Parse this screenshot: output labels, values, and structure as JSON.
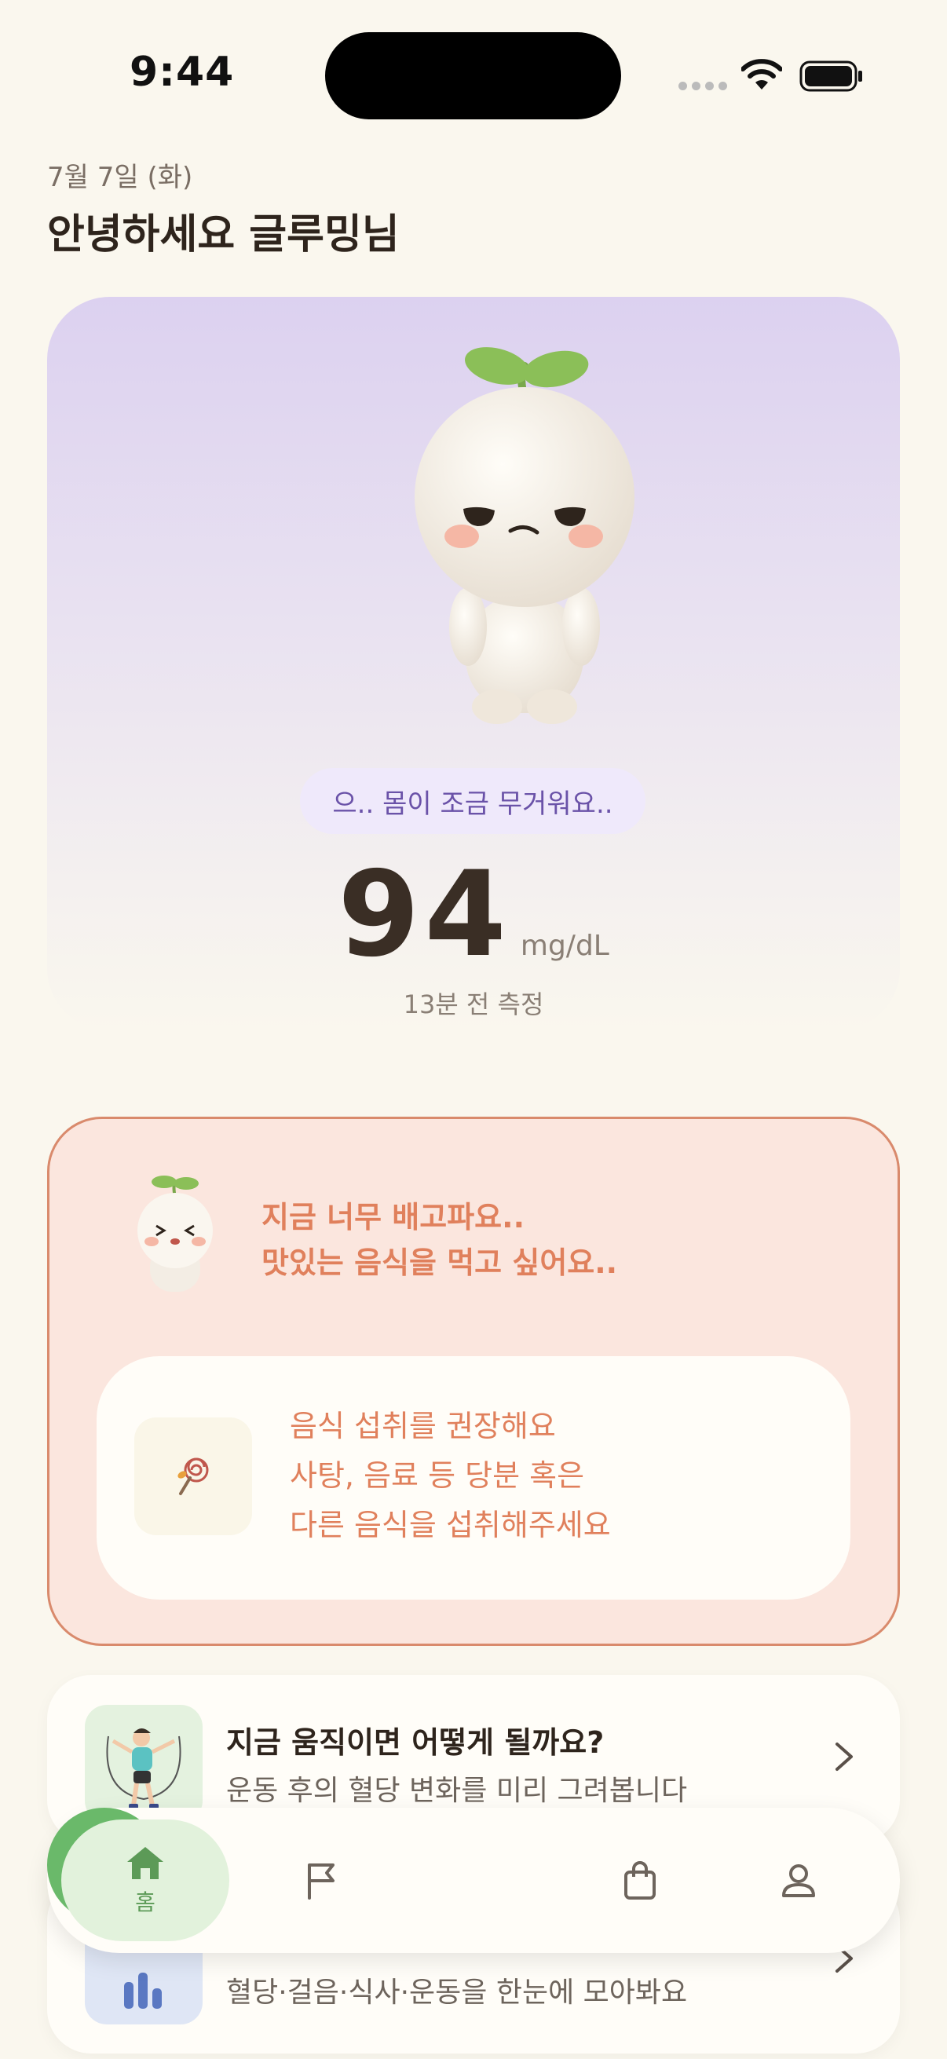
{
  "status_bar": {
    "time": "9:44"
  },
  "header": {
    "date": "7월 7일 (화)",
    "greeting": "안녕하세요 글루밍님"
  },
  "hero": {
    "mood": "으.. 몸이 조금 무거워요..",
    "glucose_value": "94",
    "glucose_unit": "mg/dL",
    "measured_ago": "13분 전 측정"
  },
  "alert": {
    "message_line1": "지금 너무 배고파요..",
    "message_line2": "맛있는 음식을 먹고 싶어요..",
    "recommendation": {
      "line1": "음식 섭취를 권장해요",
      "line2": "사탕, 음료 등 당분 혹은",
      "line3": "다른 음식을 섭취해주세요"
    }
  },
  "cards": [
    {
      "title": "지금 움직이면 어떻게 될까요?",
      "subtitle": "운동 후의 혈당 변화를 미리 그려봅니다"
    },
    {
      "subtitle": "혈당·걸음·식사·운동을 한눈에 모아봐요"
    }
  ],
  "tabbar": {
    "home_label": "홈",
    "icons": [
      "home-icon",
      "flag-icon",
      "plus-icon",
      "shopping-bag-icon",
      "profile-icon"
    ]
  },
  "colors": {
    "background": "#faf7ee",
    "accent_green": "#6ab96a",
    "alert_bg": "#fbe6de",
    "alert_text": "#e0805c",
    "mood_text": "#6a52a8"
  }
}
